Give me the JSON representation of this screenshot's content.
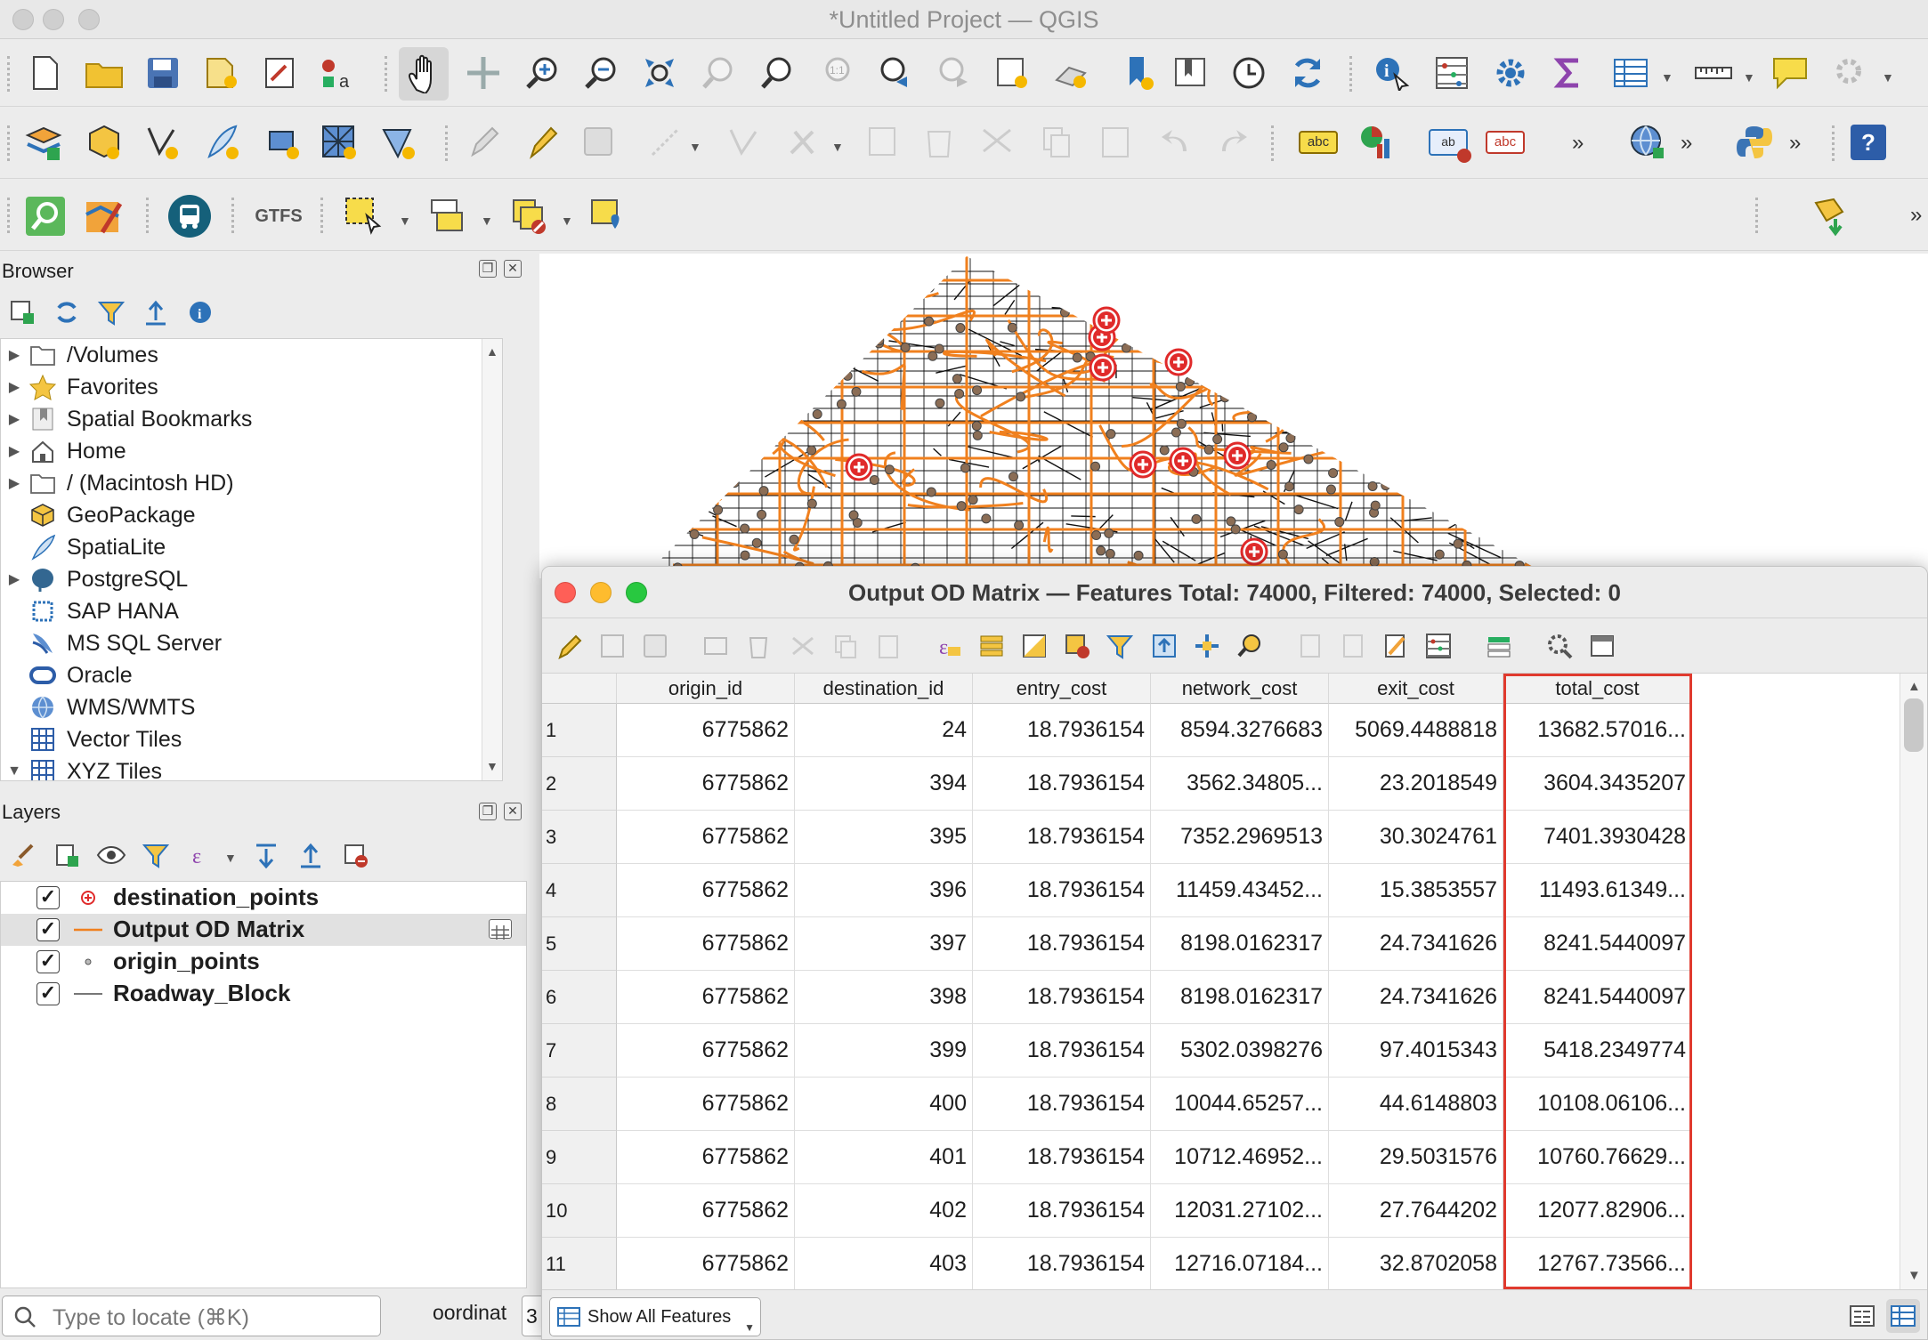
{
  "window": {
    "title": "*Untitled Project — QGIS"
  },
  "browser": {
    "title": "Browser",
    "items": [
      {
        "label": "/Volumes",
        "icon": "folder-icon",
        "expandable": true
      },
      {
        "label": "Favorites",
        "icon": "star-icon",
        "expandable": true
      },
      {
        "label": "Spatial Bookmarks",
        "icon": "bookmark-icon",
        "expandable": true
      },
      {
        "label": "Home",
        "icon": "home-icon",
        "expandable": true
      },
      {
        "label": "/ (Macintosh HD)",
        "icon": "folder-icon",
        "expandable": true
      },
      {
        "label": "GeoPackage",
        "icon": "geopackage-icon",
        "expandable": false
      },
      {
        "label": "SpatiaLite",
        "icon": "spatialite-icon",
        "expandable": false
      },
      {
        "label": "PostgreSQL",
        "icon": "postgresql-icon",
        "expandable": true
      },
      {
        "label": "SAP HANA",
        "icon": "sap-hana-icon",
        "expandable": false
      },
      {
        "label": "MS SQL Server",
        "icon": "mssql-icon",
        "expandable": false
      },
      {
        "label": "Oracle",
        "icon": "oracle-icon",
        "expandable": false
      },
      {
        "label": "WMS/WMTS",
        "icon": "globe-icon",
        "expandable": false
      },
      {
        "label": "Vector Tiles",
        "icon": "grid-icon",
        "expandable": false
      },
      {
        "label": "XYZ Tiles",
        "icon": "grid-icon",
        "expandable": true
      }
    ]
  },
  "layers": {
    "title": "Layers",
    "items": [
      {
        "label": "destination_points",
        "checked": true,
        "symbol": "red-cross-point"
      },
      {
        "label": "Output OD Matrix",
        "checked": true,
        "symbol": "orange-line",
        "selected": true
      },
      {
        "label": "origin_points",
        "checked": true,
        "symbol": "small-point"
      },
      {
        "label": "Roadway_Block",
        "checked": true,
        "symbol": "grey-line"
      }
    ]
  },
  "attribute_table": {
    "title": "Output OD Matrix — Features Total: 74000, Filtered: 74000, Selected: 0",
    "columns": [
      "origin_id",
      "destination_id",
      "entry_cost",
      "network_cost",
      "exit_cost",
      "total_cost"
    ],
    "rows": [
      {
        "n": "1",
        "origin_id": "6775862",
        "destination_id": "24",
        "entry_cost": "18.7936154",
        "network_cost": "8594.3276683",
        "exit_cost": "5069.4488818",
        "total_cost": "13682.57016..."
      },
      {
        "n": "2",
        "origin_id": "6775862",
        "destination_id": "394",
        "entry_cost": "18.7936154",
        "network_cost": "3562.34805...",
        "exit_cost": "23.2018549",
        "total_cost": "3604.3435207"
      },
      {
        "n": "3",
        "origin_id": "6775862",
        "destination_id": "395",
        "entry_cost": "18.7936154",
        "network_cost": "7352.2969513",
        "exit_cost": "30.3024761",
        "total_cost": "7401.3930428"
      },
      {
        "n": "4",
        "origin_id": "6775862",
        "destination_id": "396",
        "entry_cost": "18.7936154",
        "network_cost": "11459.43452...",
        "exit_cost": "15.3853557",
        "total_cost": "11493.61349..."
      },
      {
        "n": "5",
        "origin_id": "6775862",
        "destination_id": "397",
        "entry_cost": "18.7936154",
        "network_cost": "8198.0162317",
        "exit_cost": "24.7341626",
        "total_cost": "8241.5440097"
      },
      {
        "n": "6",
        "origin_id": "6775862",
        "destination_id": "398",
        "entry_cost": "18.7936154",
        "network_cost": "8198.0162317",
        "exit_cost": "24.7341626",
        "total_cost": "8241.5440097"
      },
      {
        "n": "7",
        "origin_id": "6775862",
        "destination_id": "399",
        "entry_cost": "18.7936154",
        "network_cost": "5302.0398276",
        "exit_cost": "97.4015343",
        "total_cost": "5418.2349774"
      },
      {
        "n": "8",
        "origin_id": "6775862",
        "destination_id": "400",
        "entry_cost": "18.7936154",
        "network_cost": "10044.65257...",
        "exit_cost": "44.6148803",
        "total_cost": "10108.06106..."
      },
      {
        "n": "9",
        "origin_id": "6775862",
        "destination_id": "401",
        "entry_cost": "18.7936154",
        "network_cost": "10712.46952...",
        "exit_cost": "29.5031576",
        "total_cost": "10760.76629..."
      },
      {
        "n": "10",
        "origin_id": "6775862",
        "destination_id": "402",
        "entry_cost": "18.7936154",
        "network_cost": "12031.27102...",
        "exit_cost": "27.7644202",
        "total_cost": "12077.82906..."
      },
      {
        "n": "11",
        "origin_id": "6775862",
        "destination_id": "403",
        "entry_cost": "18.7936154",
        "network_cost": "12716.07184...",
        "exit_cost": "32.8702058",
        "total_cost": "12767.73566..."
      }
    ],
    "highlight_column": "total_cost",
    "highlight_color": "#e03a2e",
    "show_features_label": "Show All Features"
  },
  "statusbar": {
    "locator_placeholder": "Type to locate (⌘K)",
    "coordinate_label": "oordinat",
    "coordinate_value": "3"
  },
  "toolbar": {
    "gtfs_label": "GTFS",
    "label_tool_text": "abc",
    "label_tool_text_2": "ab"
  },
  "colors": {
    "accent_orange": "#f0801e",
    "destination_red": "#e02a2a"
  }
}
